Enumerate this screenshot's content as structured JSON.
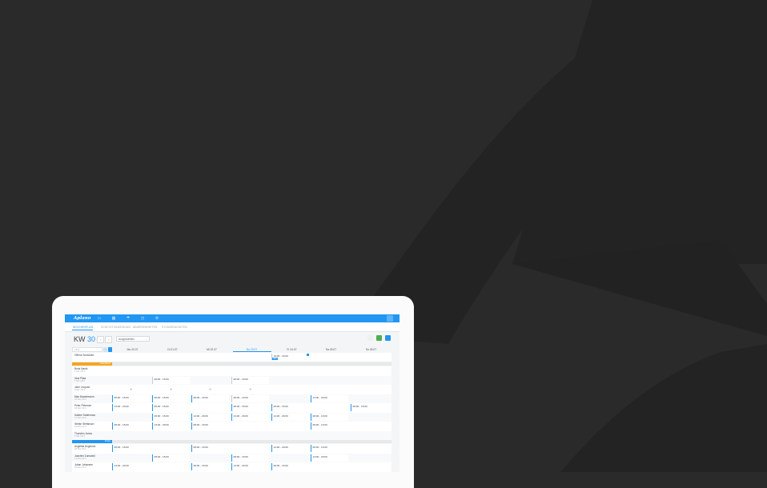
{
  "app": {
    "logo_text": "Aplano"
  },
  "nav_icons": [
    "calendar-icon",
    "calendar-grid-icon",
    "umbrella-icon",
    "clock-icon",
    "settings-icon"
  ],
  "tabs": [
    {
      "label": "WOCHENPLAN",
      "active": true
    },
    {
      "label": "SCHICHTZUWEISUNG",
      "active": false
    },
    {
      "label": "ABWESENHEITEN",
      "active": false
    },
    {
      "label": "STUNDENKONTEN",
      "active": false
    }
  ],
  "week": {
    "prefix": "KW",
    "number": "30",
    "dropdown_label": "Ausgewählten"
  },
  "filter_placeholder": "Filter...",
  "days": [
    {
      "label": "Mo 20.07",
      "today": false
    },
    {
      "label": "Di 21.07",
      "today": false
    },
    {
      "label": "Mi 22.07",
      "today": false
    },
    {
      "label": "Do 23.07",
      "today": true
    },
    {
      "label": "Fr 24.07",
      "today": false
    },
    {
      "label": "Sa 25.07",
      "today": false
    },
    {
      "label": "So 26.07",
      "today": false
    }
  ],
  "open_shifts": {
    "label": "Offene Schichten",
    "shift": "16:00 - 16:00",
    "badge": "offen"
  },
  "groups": [
    {
      "tag": "Lieferdienst",
      "color": "#f5a623"
    },
    {
      "tag": "Küche",
      "color": "#2196f3"
    }
  ],
  "employees": [
    {
      "name": "Boris Nashi",
      "sub": "4 Std | 40 h"
    },
    {
      "name": "Irina Pilaa",
      "sub": "7 Std | 28 h"
    },
    {
      "name": "Jane Leopold",
      "sub": "8 Std | 40 h"
    },
    {
      "name": "Max Mustermann",
      "sub": "22 Std | 40 h"
    },
    {
      "name": "Peter Petersen",
      "sub": "18 Std | 30 h"
    },
    {
      "name": "Sabine Sabrinowa",
      "sub": "17 Std | 40 h"
    },
    {
      "name": "Stefan Stefanson",
      "sub": "24 Std | 40 h"
    },
    {
      "name": "Thorsten Janus",
      "sub": "0 Std | 18 h"
    },
    {
      "name": "Angelika Angelova",
      "sub": "18 Std | 40 h"
    },
    {
      "name": "Joachim Zumwald",
      "sub": "14 Std | 40 h"
    },
    {
      "name": "Julian Johansen",
      "sub": "26 Std | 40 h"
    }
  ],
  "shifts": [
    {
      "row": 1,
      "day": 1,
      "text": "08:00 - 15:00",
      "gray": true
    },
    {
      "row": 1,
      "day": 3,
      "text": "08:00 - 15:00",
      "gray": true
    },
    {
      "row": 3,
      "day": 0,
      "text": "08:00 - 15:00",
      "gray": false
    },
    {
      "row": 3,
      "day": 1,
      "text": "08:00 - 15:00",
      "gray": false
    },
    {
      "row": 3,
      "day": 2,
      "text": "08:00 - 15:00",
      "gray": false
    },
    {
      "row": 3,
      "day": 3,
      "text": "08:00 - 15:00",
      "gray": true
    },
    {
      "row": 3,
      "day": 5,
      "text": "13:00 - 20:00",
      "gray": false
    },
    {
      "row": 4,
      "day": 0,
      "text": "13:00 - 20:00",
      "gray": false
    },
    {
      "row": 4,
      "day": 1,
      "text": "08:00 - 15:00",
      "gray": false
    },
    {
      "row": 4,
      "day": 3,
      "text": "08:00 - 15:00",
      "gray": false
    },
    {
      "row": 4,
      "day": 4,
      "text": "08:00 - 15:00",
      "gray": false
    },
    {
      "row": 4,
      "day": 6,
      "text": "08:00 - 15:00",
      "gray": false
    },
    {
      "row": 5,
      "day": 1,
      "text": "08:00 - 15:00",
      "gray": false
    },
    {
      "row": 5,
      "day": 2,
      "text": "14:00 - 20:00",
      "gray": false
    },
    {
      "row": 5,
      "day": 3,
      "text": "14:00 - 20:00",
      "gray": false
    },
    {
      "row": 5,
      "day": 4,
      "text": "14:00 - 20:00",
      "gray": false
    },
    {
      "row": 5,
      "day": 5,
      "text": "08:00 - 13:00",
      "gray": false
    },
    {
      "row": 6,
      "day": 0,
      "text": "08:00 - 15:00",
      "gray": false
    },
    {
      "row": 6,
      "day": 1,
      "text": "13:00 - 20:00",
      "gray": false
    },
    {
      "row": 6,
      "day": 2,
      "text": "08:00 - 15:00",
      "gray": false
    },
    {
      "row": 6,
      "day": 5,
      "text": "08:00 - 13:00",
      "gray": false
    },
    {
      "row": 8,
      "day": 0,
      "text": "08:00 - 15:00",
      "gray": false
    },
    {
      "row": 8,
      "day": 2,
      "text": "08:00 - 15:00",
      "gray": false
    },
    {
      "row": 8,
      "day": 4,
      "text": "14:00 - 20:00",
      "gray": false
    },
    {
      "row": 8,
      "day": 5,
      "text": "08:00 - 13:00",
      "gray": false
    },
    {
      "row": 9,
      "day": 1,
      "text": "08:00 - 15:00",
      "gray": false
    },
    {
      "row": 9,
      "day": 3,
      "text": "08:00 - 15:00",
      "gray": false
    },
    {
      "row": 9,
      "day": 5,
      "text": "13:00 - 20:00",
      "gray": false
    },
    {
      "row": 10,
      "day": 0,
      "text": "13:00 - 20:00",
      "gray": false
    },
    {
      "row": 10,
      "day": 2,
      "text": "08:00 - 15:00",
      "gray": false
    },
    {
      "row": 10,
      "day": 3,
      "text": "13:00 - 20:00",
      "gray": false
    },
    {
      "row": 10,
      "day": 4,
      "text": "08:00 - 15:00",
      "gray": false
    }
  ],
  "absences": [
    {
      "row": 2,
      "day": 0,
      "icon": "plane-icon"
    },
    {
      "row": 2,
      "day": 1,
      "icon": "plane-icon"
    },
    {
      "row": 2,
      "day": 2,
      "icon": "plane-icon"
    },
    {
      "row": 2,
      "day": 3,
      "icon": "plane-icon"
    }
  ],
  "colors": {
    "accent": "#2196f3",
    "green": "#4caf50",
    "orange": "#f5a623",
    "background": "#2a2a2b"
  }
}
